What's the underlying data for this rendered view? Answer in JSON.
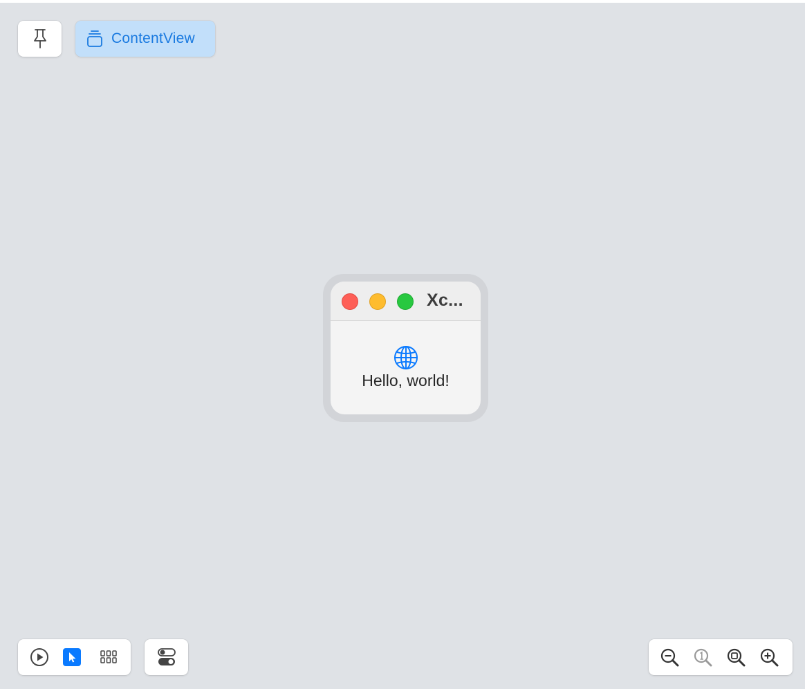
{
  "top_bar": {
    "pin_icon": "pin-icon",
    "content_view_label": "ContentView",
    "content_view_icon": "stacked-window-icon"
  },
  "preview_window": {
    "title": "Xc...",
    "icon": "globe-icon",
    "text": "Hello, world!"
  },
  "bottom_left": {
    "modes": [
      {
        "name": "live-mode",
        "icon": "play-circle-icon",
        "selected": false
      },
      {
        "name": "selectable-mode",
        "icon": "cursor-arrow-icon",
        "selected": true
      },
      {
        "name": "variants-mode",
        "icon": "grid-icon",
        "selected": false
      }
    ],
    "device_settings_icon": "toggle-switches-icon"
  },
  "bottom_right": {
    "zoom": [
      {
        "name": "zoom-out",
        "icon": "zoom-out-icon",
        "enabled": true
      },
      {
        "name": "zoom-100",
        "icon": "zoom-actual-size-icon",
        "enabled": false
      },
      {
        "name": "zoom-to-fit",
        "icon": "zoom-to-fit-icon",
        "enabled": true
      },
      {
        "name": "zoom-in",
        "icon": "zoom-in-icon",
        "enabled": true
      }
    ]
  },
  "colors": {
    "canvas_bg": "#dfe2e6",
    "accent": "#0a7aff",
    "content_view_bg": "#c2dffa",
    "content_view_text": "#1a7ae0",
    "traffic_red": "#fe5f57",
    "traffic_yellow": "#febc2e",
    "traffic_green": "#28c840"
  }
}
